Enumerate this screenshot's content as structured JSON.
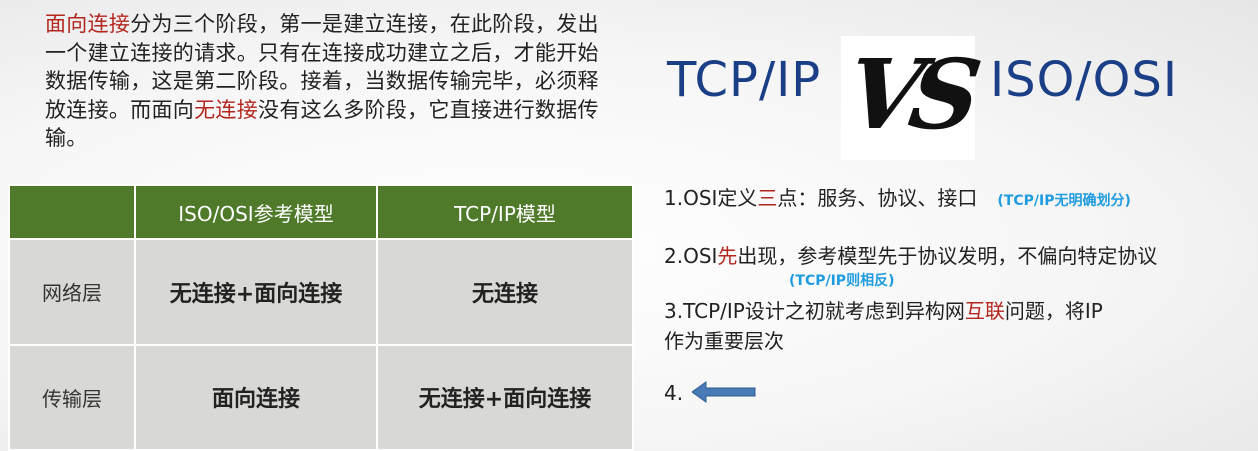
{
  "paragraph": {
    "term1": "面向连接",
    "text1": "分为三个阶段，第一是建立连接，在此阶段，发出一个建立连接的请求。只有在连接成功建立之后，才能开始数据传输，这是第二阶段。接着，当数据传输完毕，必须释放连接。而面向",
    "term2": "无连接",
    "text2": "没有这么多阶段，它直接进行数据传输。"
  },
  "table": {
    "headers": [
      "",
      "ISO/OSI参考模型",
      "TCP/IP模型"
    ],
    "rows": [
      {
        "layer": "网络层",
        "osi": "无连接+面向连接",
        "tcp": "无连接"
      },
      {
        "layer": "传输层",
        "osi": "面向连接",
        "tcp": "无连接+面向连接"
      }
    ]
  },
  "banner": {
    "left": "TCP/IP",
    "vs": "VS",
    "right": "ISO/OSI"
  },
  "notes": {
    "n1_a": "1.OSI定义",
    "n1_red": "三",
    "n1_b": "点：服务、协议、接口",
    "n1_hint": "(TCP/IP无明确划分)",
    "n2_a": "2.OSI",
    "n2_red": "先",
    "n2_b": "出现，参考模型先于协议发明，不偏向特定协议",
    "n2_hint": "(TCP/IP则相反)",
    "n3_a": "3.TCP/IP设计之初就考虑到异构网",
    "n3_red": "互联",
    "n3_b": "问题，将IP",
    "n3_c": "作为重要层次",
    "n4": "4."
  },
  "colors": {
    "accent_red": "#b3261e",
    "title_blue": "#1b3f86",
    "hint_blue": "#1f9be0",
    "header_green": "#4e7a2a",
    "arrow_blue": "#4a7ab5"
  },
  "icons": [
    "left-arrow-icon"
  ]
}
